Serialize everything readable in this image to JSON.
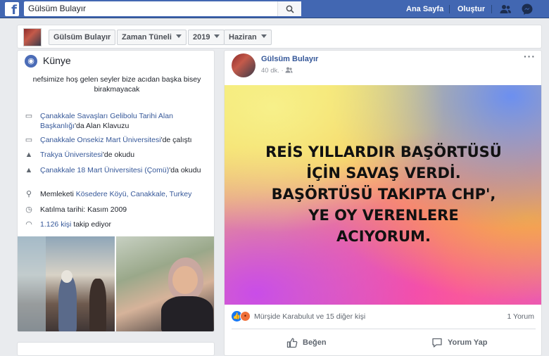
{
  "topbar": {
    "logo": "f",
    "search_value": "Gülsüm Bulayır",
    "nav": [
      "Ana Sayfa",
      "Oluştur"
    ]
  },
  "timeline_nav": {
    "name": "Gülsüm Bulayır",
    "section": "Zaman Tüneli",
    "year": "2019",
    "month": "Haziran"
  },
  "intro": {
    "title": "Künye",
    "bio": "nefsimize hoş gelen seyler bize acıdan başka bisey birakmayacak",
    "items": [
      {
        "icon": "briefcase-icon",
        "link": "Çanakkale Savaşları Gelibolu Tarihi Alan Başkanlığı",
        "text": "'da Alan Klavuzu"
      },
      {
        "icon": "briefcase-icon",
        "link": "Çanakkale Onsekiz Mart Üniversitesi",
        "text": "'de çalıştı"
      },
      {
        "icon": "graduation-cap-icon",
        "link": "Trakya Üniversitesi",
        "text": "'de okudu"
      },
      {
        "icon": "graduation-cap-icon",
        "link": "Çanakkale 18 Mart Üniversitesi (Çomü)",
        "text": "'da okudu"
      },
      {
        "icon": "location-pin-icon",
        "prefix": "Memleketi ",
        "link": "Kösedere Köyü, Canakkale, Turkey",
        "text": ""
      },
      {
        "icon": "clock-icon",
        "prefix": "Katılma tarihi: Kasım 2009",
        "link": "",
        "text": ""
      },
      {
        "icon": "rss-icon",
        "prefix": "",
        "link": "1.126 kişi",
        "text": " takip ediyor"
      }
    ]
  },
  "post": {
    "author": "Gülsüm Bulayır",
    "time": "40 dk. ·",
    "more": "···",
    "image_text": "REİS YILLARDIR BAŞÖRTÜSÜ\nİÇİN SAVAŞ VERDİ.\nBAŞÖRTÜSÜ TAKIPTA CHP',\nYE OY VERENLERE\nACIYORUM.",
    "reactions_text": "Mürşide Karabulut ve 15 diğer kişi",
    "comments_text": "1 Yorum",
    "like_label": "Beğen",
    "comment_label": "Yorum Yap"
  },
  "colors": {
    "brand": "#4267b2",
    "link": "#365899"
  }
}
